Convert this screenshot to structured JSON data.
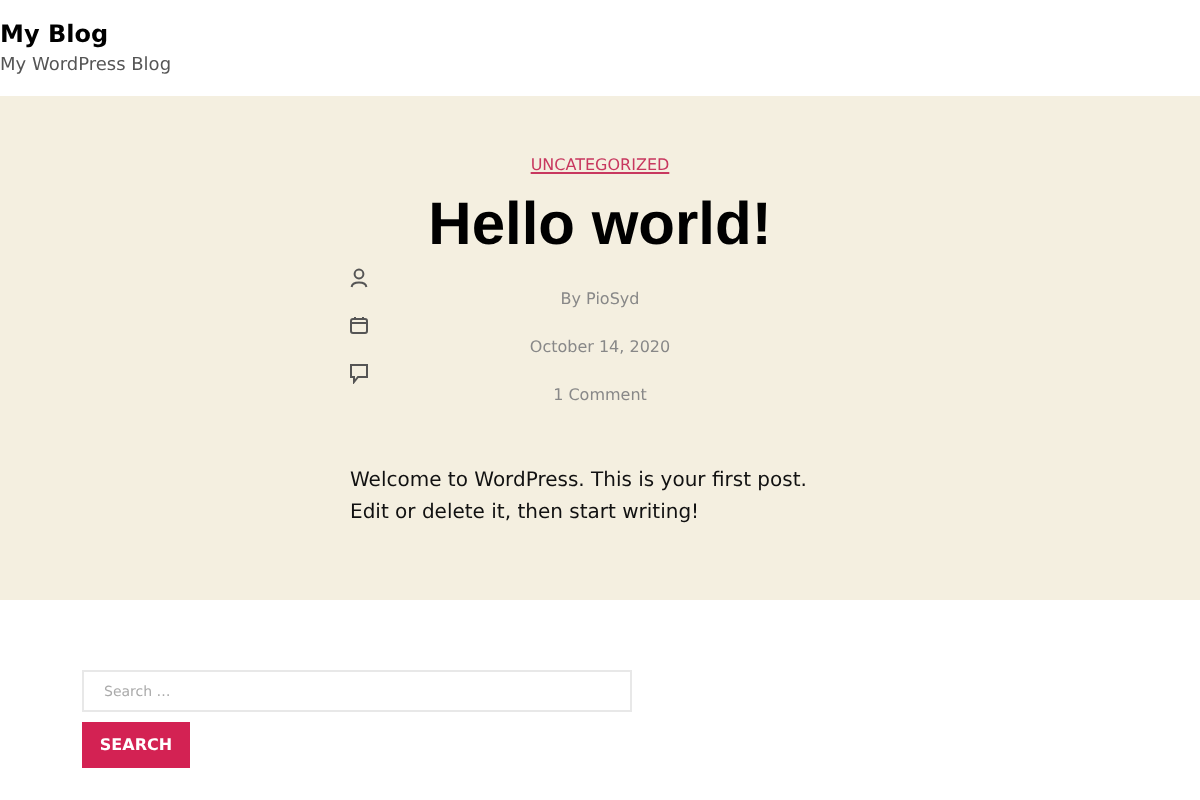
{
  "site": {
    "title": "My Blog",
    "tagline": "My WordPress Blog"
  },
  "post": {
    "category": "UNCATEGORIZED",
    "title": "Hello world!",
    "meta": [
      {
        "kind": "author",
        "text": "By PioSyd"
      },
      {
        "kind": "date",
        "text": "October 14, 2020"
      },
      {
        "kind": "comments",
        "text": "1 Comment"
      }
    ],
    "body": "Welcome to WordPress. This is your first post. Edit or delete it, then start writing!"
  },
  "search": {
    "placeholder": "Search …",
    "button": "SEARCH"
  }
}
